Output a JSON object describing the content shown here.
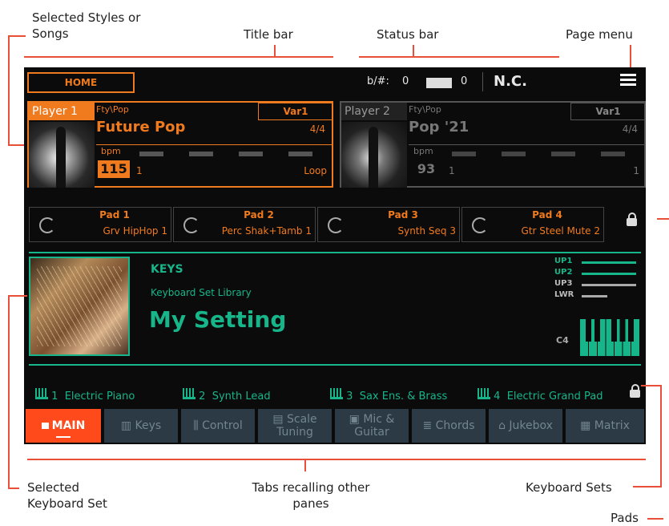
{
  "annotations": {
    "selected_styles": [
      "Selected Styles or",
      "Songs"
    ],
    "title_bar": "Title bar",
    "status_bar": "Status bar",
    "page_menu": "Page menu",
    "selected_keyboard_set": [
      "Selected",
      "Keyboard Set"
    ],
    "tabs_recalling": [
      "Tabs recalling other",
      "panes"
    ],
    "keyboard_sets": "Keyboard Sets",
    "pads": "Pads"
  },
  "title_bar": {
    "home_label": "HOME"
  },
  "status_bar": {
    "transpose_label": "b/#:",
    "transpose_value": "0",
    "octave_value": "0",
    "chord": "N.C."
  },
  "player1": {
    "label": "Player 1",
    "category": "Fty\\Pop",
    "variation": "Var1",
    "name": "Future Pop",
    "meter": "4/4",
    "bpm_label": "bpm",
    "bpm": "115",
    "measure": "1",
    "mode": "Loop"
  },
  "player2": {
    "label": "Player 2",
    "category": "Fty\\Pop",
    "variation": "Var1",
    "name": "Pop '21",
    "meter": "4/4",
    "bpm_label": "bpm",
    "bpm": "93",
    "measure": "1",
    "measure_end": "1"
  },
  "pads": [
    {
      "title": "Pad 1",
      "name": "Grv HipHop 1"
    },
    {
      "title": "Pad 2",
      "name": "Perc Shak+Tamb 1"
    },
    {
      "title": "Pad 3",
      "name": "Synth Seq 3"
    },
    {
      "title": "Pad 4",
      "name": "Gtr Steel Mute 2"
    }
  ],
  "keyboard_set": {
    "category": "KEYS",
    "library": "Keyboard Set Library",
    "name": "My Setting",
    "note": "C4",
    "layers": [
      {
        "label": "UP1",
        "active": true
      },
      {
        "label": "UP2",
        "active": true
      },
      {
        "label": "UP3",
        "active": false
      },
      {
        "label": "LWR",
        "active": false
      }
    ]
  },
  "keyboard_sets": [
    {
      "num": "1",
      "name": "Electric Piano"
    },
    {
      "num": "2",
      "name": "Synth Lead"
    },
    {
      "num": "3",
      "name": "Sax Ens. & Brass"
    },
    {
      "num": "4",
      "name": "Electric Grand Pad"
    }
  ],
  "tabs": [
    {
      "label": "MAIN",
      "active": true
    },
    {
      "label": "Keys"
    },
    {
      "label": "Control"
    },
    {
      "label": "Scale Tuning"
    },
    {
      "label": "Mic & Guitar"
    },
    {
      "label": "Chords"
    },
    {
      "label": "Jukebox"
    },
    {
      "label": "Matrix"
    }
  ],
  "colors": {
    "accent": "#f07a1e",
    "teal": "#17b58a",
    "tab_active": "#ff4a1c",
    "tab": "#2b3a44",
    "annotation_line": "#e8503a"
  }
}
